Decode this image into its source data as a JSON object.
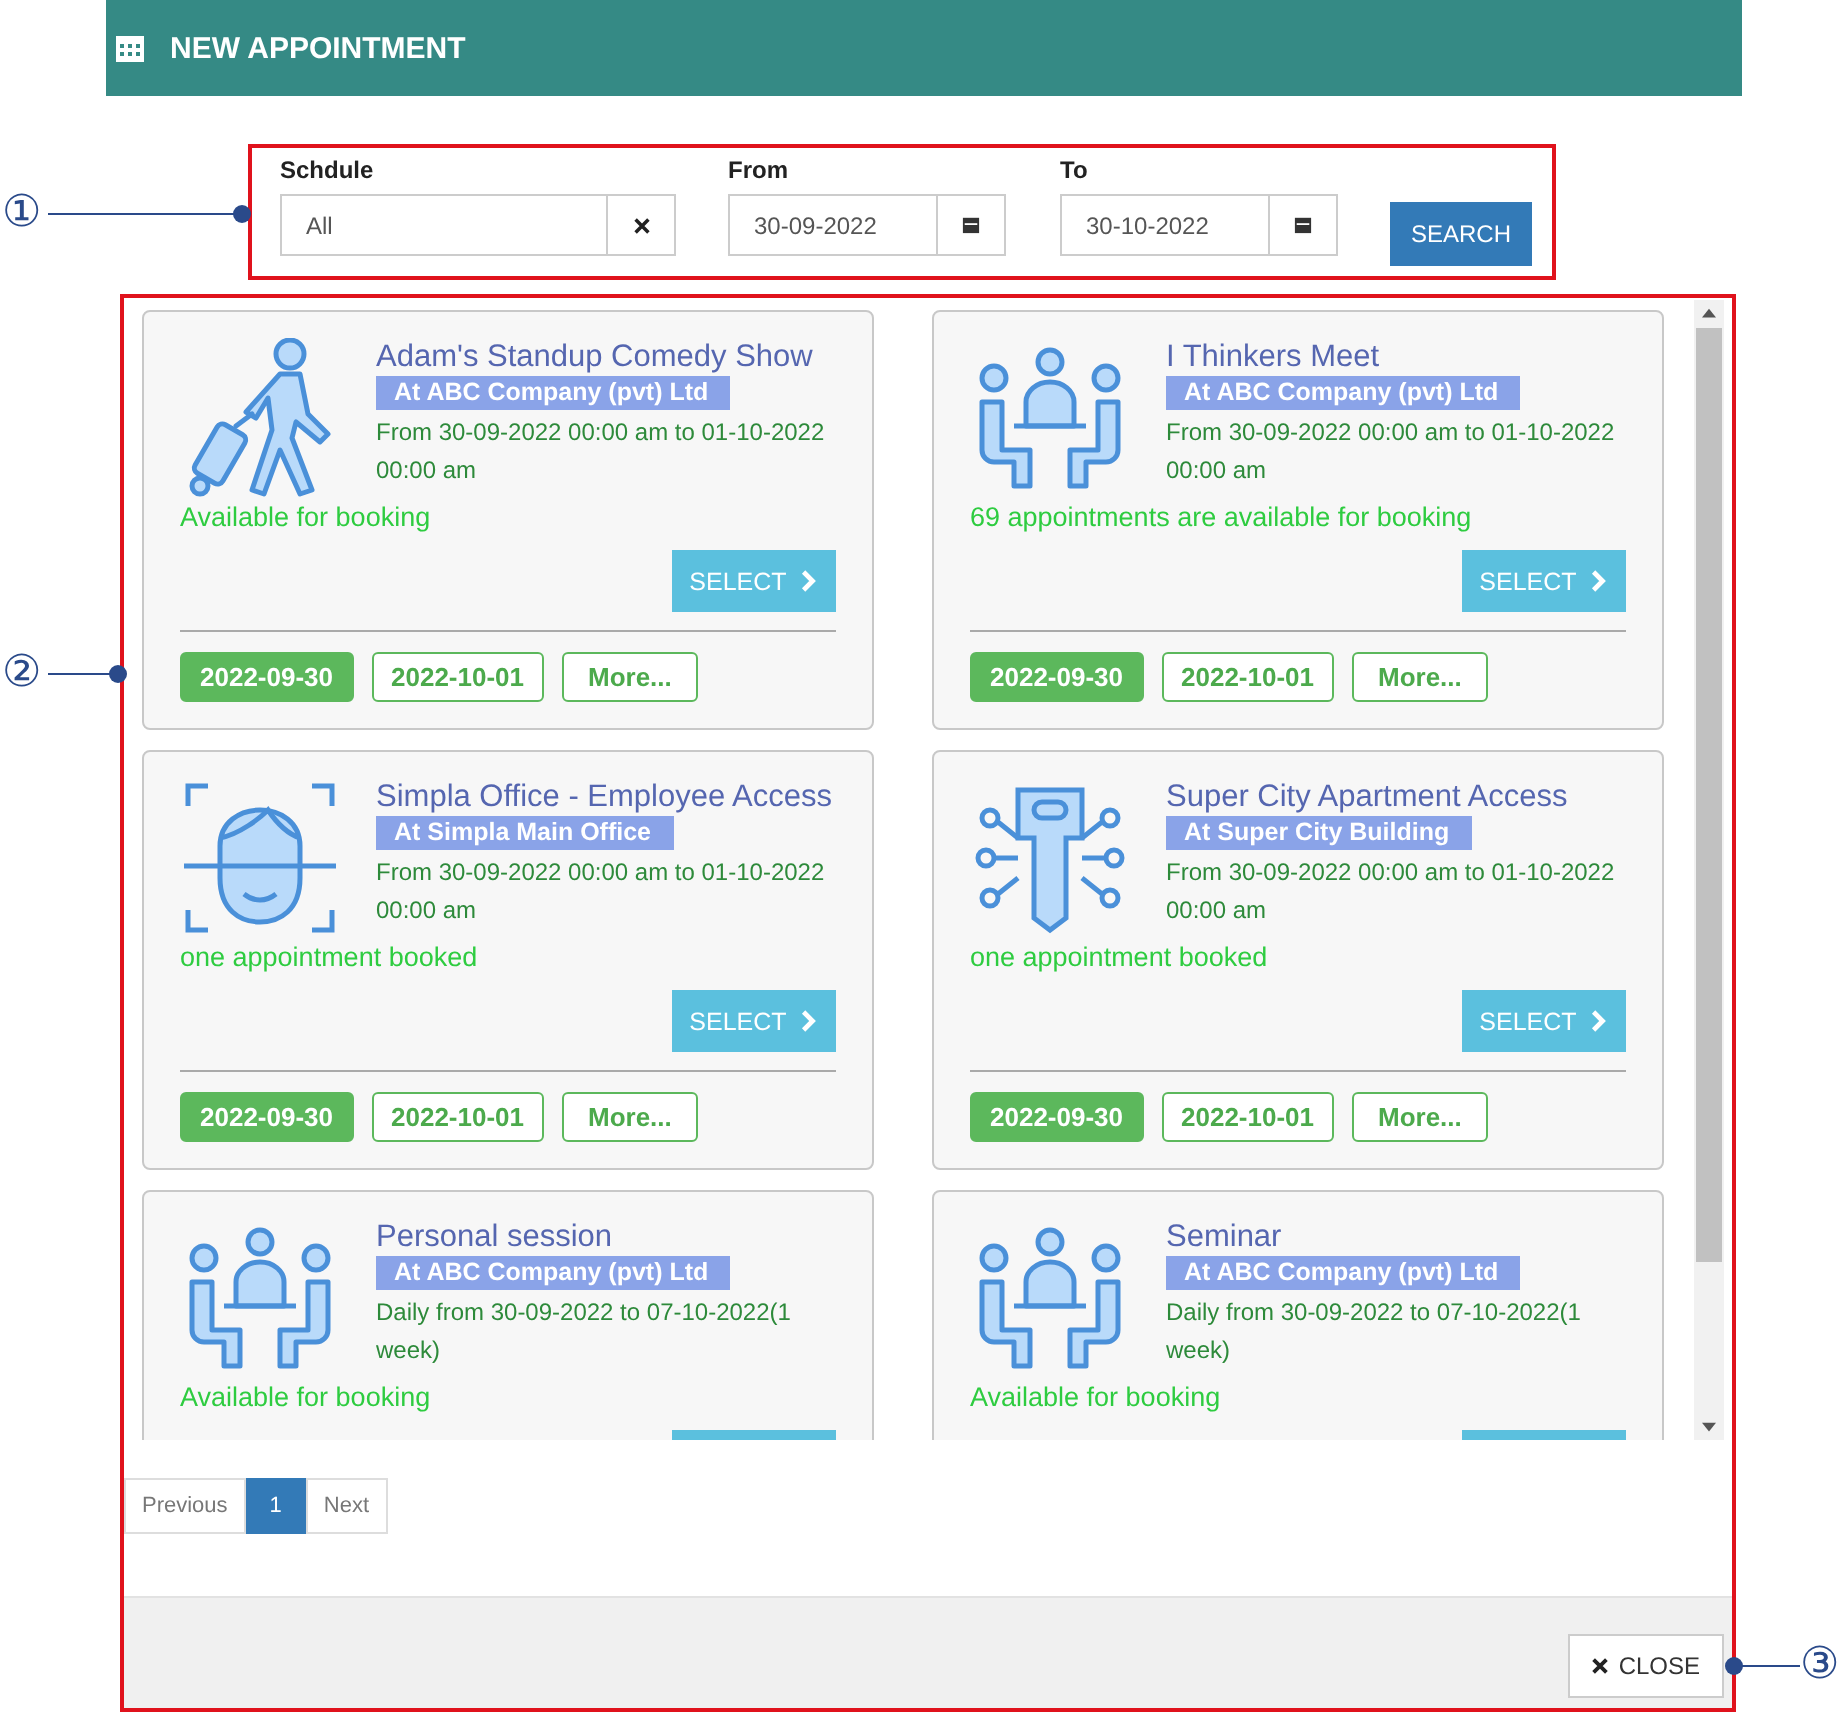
{
  "header": {
    "title": "NEW APPOINTMENT"
  },
  "filters": {
    "schedule": {
      "label": "Schdule",
      "value": "All"
    },
    "from": {
      "label": "From",
      "value": "30-09-2022"
    },
    "to": {
      "label": "To",
      "value": "30-10-2022"
    },
    "search_button": "SEARCH"
  },
  "appointments": [
    {
      "kind": "traveler",
      "title": "Adam's Standup Comedy Show",
      "location": "At ABC Company (pvt) Ltd",
      "time": "From 30-09-2022 00:00 am to 01-10-2022 00:00 am",
      "availability": "Available for booking",
      "select_button": "SELECT",
      "dates": [
        {
          "label": "2022-09-30",
          "selected": true
        },
        {
          "label": "2022-10-01",
          "selected": false
        }
      ],
      "more_button": "More..."
    },
    {
      "kind": "meeting",
      "title": "I Thinkers Meet",
      "location": "At ABC Company (pvt) Ltd",
      "time": "From 30-09-2022 00:00 am to 01-10-2022 00:00 am",
      "availability": "69 appointments are available for booking",
      "select_button": "SELECT",
      "dates": [
        {
          "label": "2022-09-30",
          "selected": true
        },
        {
          "label": "2022-10-01",
          "selected": false
        }
      ],
      "more_button": "More..."
    },
    {
      "kind": "face-scan",
      "title": "Simpla Office - Employee Access",
      "location": "At Simpla Main Office",
      "time": "From 30-09-2022 00:00 am to 01-10-2022 00:00 am",
      "availability": "one appointment booked",
      "select_button": "SELECT",
      "dates": [
        {
          "label": "2022-09-30",
          "selected": true
        },
        {
          "label": "2022-10-01",
          "selected": false
        }
      ],
      "more_button": "More..."
    },
    {
      "kind": "key",
      "title": "Super City Apartment Access",
      "location": "At Super City Building",
      "time": "From 30-09-2022 00:00 am to 01-10-2022 00:00 am",
      "availability": "one appointment booked",
      "select_button": "SELECT",
      "dates": [
        {
          "label": "2022-09-30",
          "selected": true
        },
        {
          "label": "2022-10-01",
          "selected": false
        }
      ],
      "more_button": "More..."
    },
    {
      "kind": "meeting",
      "title": "Personal session",
      "location": "At ABC Company (pvt) Ltd",
      "time": "Daily from 30-09-2022 to 07-10-2022(1 week)",
      "availability": "Available for booking"
    },
    {
      "kind": "meeting",
      "title": "Seminar",
      "location": "At ABC Company (pvt) Ltd",
      "time": "Daily from 30-09-2022 to 07-10-2022(1 week)",
      "availability": "Available for booking"
    }
  ],
  "pagination": {
    "previous": "Previous",
    "pages": [
      {
        "label": "1",
        "selected": true
      }
    ],
    "next": "Next"
  },
  "close_button": "CLOSE",
  "callouts": [
    "①",
    "②",
    "③"
  ]
}
